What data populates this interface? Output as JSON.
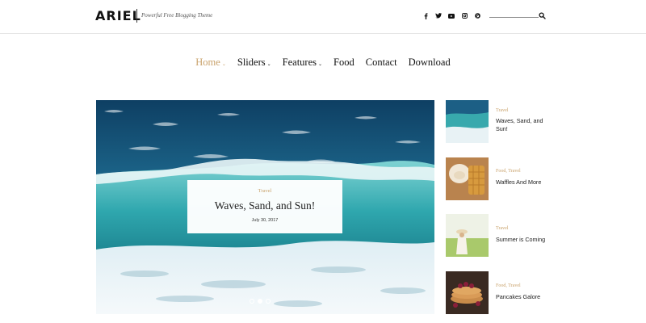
{
  "site": {
    "logo": "ARIEL",
    "tagline": "Powerful Free Blogging Theme"
  },
  "social": [
    {
      "icon": "facebook-icon"
    },
    {
      "icon": "twitter-icon"
    },
    {
      "icon": "youtube-icon"
    },
    {
      "icon": "instagram-icon"
    },
    {
      "icon": "pinterest-icon"
    }
  ],
  "search": {
    "placeholder": "",
    "value": ""
  },
  "nav": {
    "items": [
      {
        "label": "Home",
        "caret": "⌄",
        "active": true
      },
      {
        "label": "Sliders",
        "caret": "⌄"
      },
      {
        "label": "Features",
        "caret": "⌄"
      },
      {
        "label": "Food",
        "caret": ""
      },
      {
        "label": "Contact",
        "caret": ""
      },
      {
        "label": "Download",
        "caret": ""
      }
    ]
  },
  "hero": {
    "category": "Travel",
    "title": "Waves, Sand, and Sun!",
    "date": "July 30, 2017",
    "active_slide": 1,
    "slide_count": 3
  },
  "sidebar": {
    "posts": [
      {
        "category": "Travel",
        "title": "Waves, Sand, and Sun!"
      },
      {
        "category": "Food, Travel",
        "title": "Waffles And More"
      },
      {
        "category": "Travel",
        "title": "Summer is Coming"
      },
      {
        "category": "Food, Travel",
        "title": "Pancakes Galore"
      }
    ]
  },
  "colors": {
    "accent": "#c9a26b",
    "text": "#222222",
    "border": "#e6e6e6"
  }
}
